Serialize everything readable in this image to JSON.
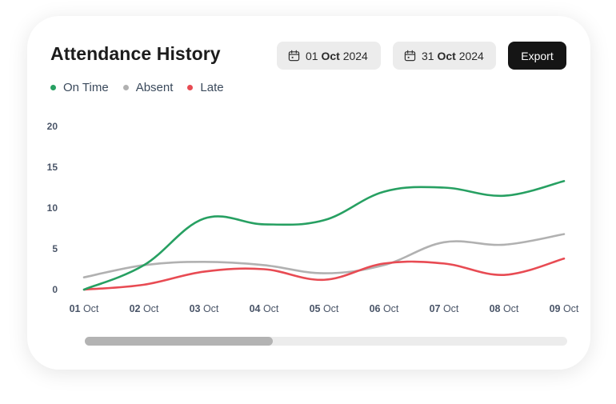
{
  "card": {
    "title": "Attendance History",
    "start_date": {
      "day": "01",
      "month": "Oct",
      "year": "2024"
    },
    "end_date": {
      "day": "31",
      "month": "Oct",
      "year": "2024"
    },
    "export_label": "Export",
    "icons": {
      "date": "calendar-icon"
    }
  },
  "scrollbar": {
    "thumb_fraction": 0.39,
    "position": 0
  },
  "chart_data": {
    "type": "line",
    "title": "",
    "xlabel": "",
    "ylabel": "",
    "ylim": [
      0,
      20
    ],
    "yticks": [
      0,
      5,
      10,
      15,
      20
    ],
    "legend_position": "top-left",
    "grid": false,
    "curve": "smooth",
    "categories": [
      {
        "day": "01",
        "month": "Oct"
      },
      {
        "day": "02",
        "month": "Oct"
      },
      {
        "day": "03",
        "month": "Oct"
      },
      {
        "day": "04",
        "month": "Oct"
      },
      {
        "day": "05",
        "month": "Oct"
      },
      {
        "day": "06",
        "month": "Oct"
      },
      {
        "day": "07",
        "month": "Oct"
      },
      {
        "day": "08",
        "month": "Oct"
      },
      {
        "day": "09",
        "month": "Oct"
      }
    ],
    "series": [
      {
        "name": "On Time",
        "color": "#27a062",
        "values": [
          0,
          3,
          8.7,
          8,
          8.5,
          12,
          12.5,
          11.5,
          13.3
        ]
      },
      {
        "name": "Absent",
        "color": "#b1b1b1",
        "values": [
          1.5,
          3,
          3.4,
          3,
          2,
          3,
          5.8,
          5.5,
          6.8
        ]
      },
      {
        "name": "Late",
        "color": "#e84b53",
        "values": [
          0,
          0.6,
          2.2,
          2.5,
          1.2,
          3.2,
          3.2,
          1.8,
          3.8
        ]
      }
    ]
  }
}
